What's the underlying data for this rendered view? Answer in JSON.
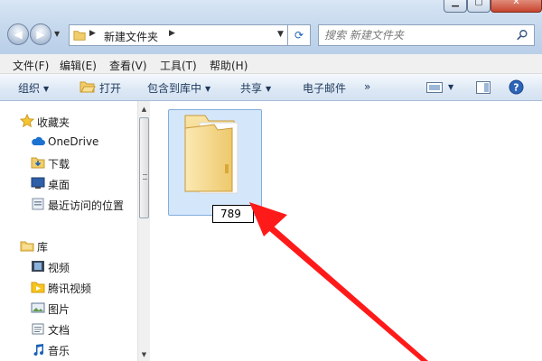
{
  "window": {
    "controls": {
      "minimize_icon": "minimize-icon",
      "maximize_icon": "maximize-icon",
      "close_icon": "close-icon"
    }
  },
  "nav": {
    "back_icon": "back-arrow-icon",
    "forward_icon": "forward-arrow-icon",
    "address": {
      "crumb": "新建文件夹"
    },
    "refresh_icon": "refresh-icon",
    "search": {
      "placeholder": "搜索 新建文件夹"
    }
  },
  "menubar": {
    "items": [
      {
        "label": "文件(F)"
      },
      {
        "label": "编辑(E)"
      },
      {
        "label": "查看(V)"
      },
      {
        "label": "工具(T)"
      },
      {
        "label": "帮助(H)"
      }
    ]
  },
  "toolbar": {
    "organize": "组织",
    "open": "打开",
    "include_in_library": "包含到库中",
    "share": "共享",
    "email": "电子邮件",
    "more": "»"
  },
  "sidebar": {
    "favorites_header": "收藏夹",
    "favorites": [
      {
        "label": "OneDrive",
        "icon": "cloud-icon"
      },
      {
        "label": "下载",
        "icon": "downloads-icon"
      },
      {
        "label": "桌面",
        "icon": "desktop-icon"
      },
      {
        "label": "最近访问的位置",
        "icon": "recent-places-icon"
      }
    ],
    "libraries_header": "库",
    "libraries": [
      {
        "label": "视频",
        "icon": "video-icon"
      },
      {
        "label": "腾讯视频",
        "icon": "tencent-video-icon"
      },
      {
        "label": "图片",
        "icon": "pictures-icon"
      },
      {
        "label": "文档",
        "icon": "documents-icon"
      },
      {
        "label": "音乐",
        "icon": "music-icon"
      }
    ]
  },
  "content": {
    "folder": {
      "rename_value": "789",
      "icon": "folder-icon"
    }
  },
  "annotation": {
    "arrow_color": "#ff1a1a"
  },
  "colors": {
    "selection": "#d4e6fa",
    "selection_border": "#84acdd",
    "toolbar_text": "#1e395b"
  }
}
